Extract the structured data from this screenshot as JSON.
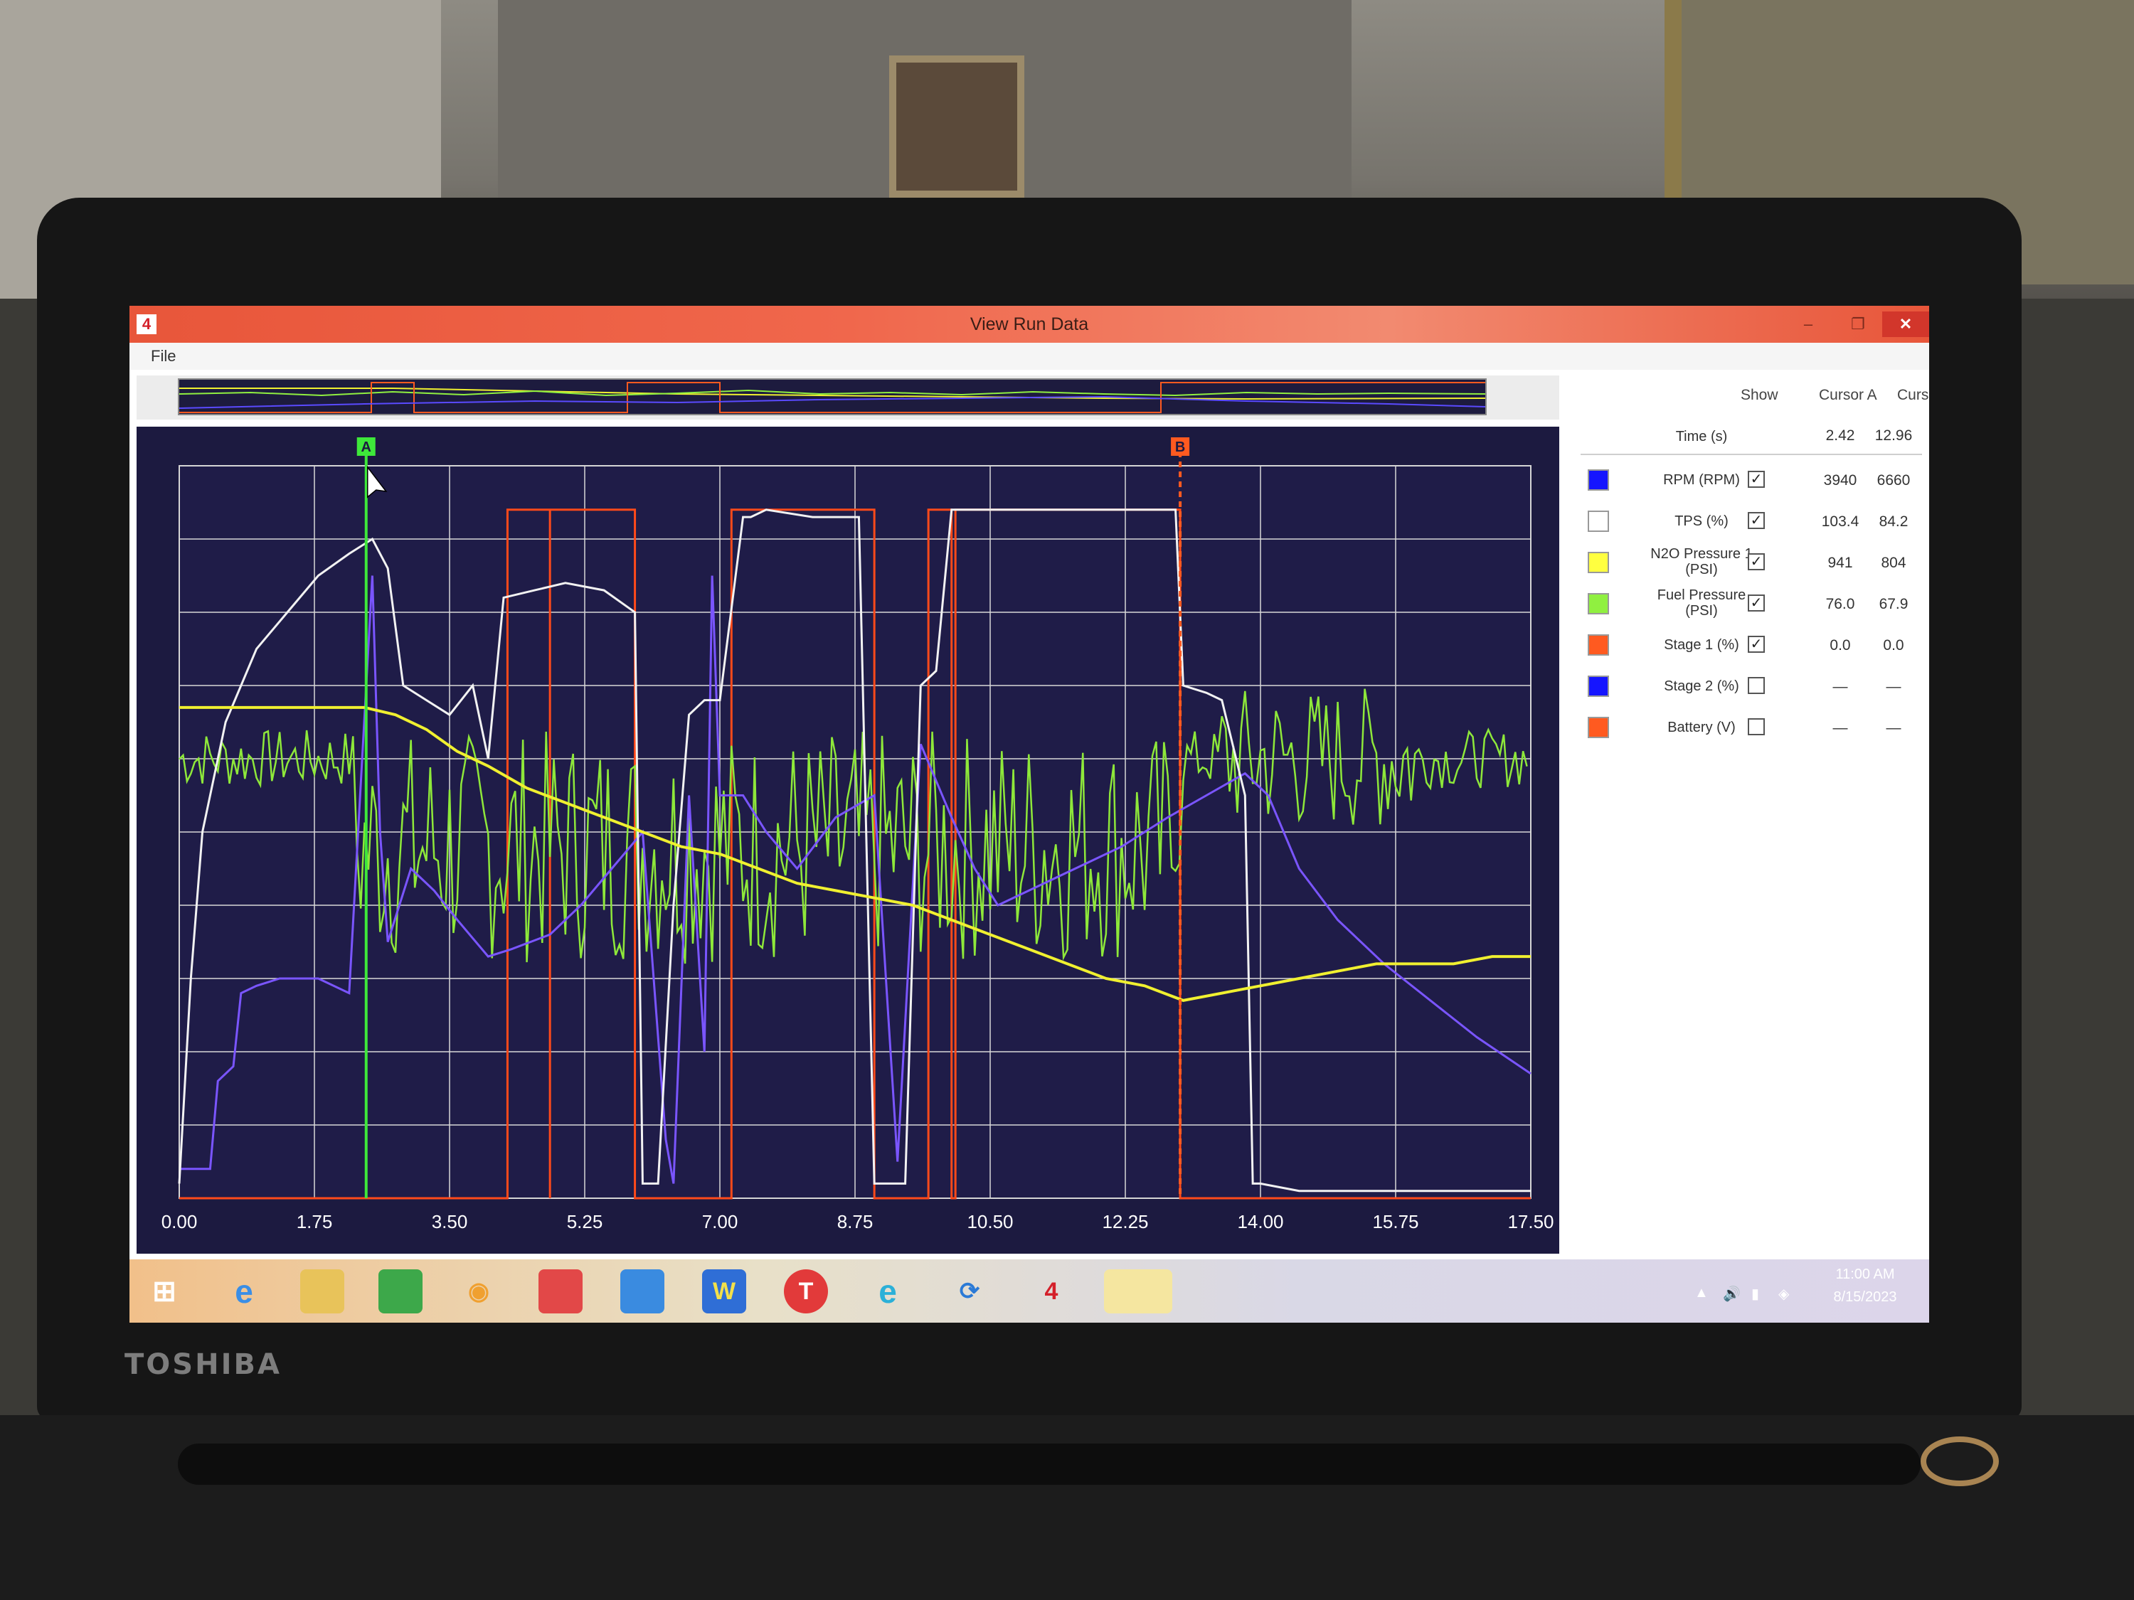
{
  "window": {
    "title": "View Run Data",
    "minimize": "–",
    "maximize": "❐",
    "close": "✕"
  },
  "menu": {
    "file": "File"
  },
  "device": {
    "brand": "TOSHIBA"
  },
  "legend": {
    "headers": {
      "show": "Show",
      "cursor_a": "Cursor A",
      "cursor_b": "Cursor B"
    },
    "time_label": "Time (s)",
    "time_a": "2.42",
    "time_b": "12.96",
    "rows": [
      {
        "label": "RPM (RPM)",
        "color": "#1515ff",
        "checked": true,
        "a": "3940",
        "b": "6660"
      },
      {
        "label": "TPS (%)",
        "color": "#ffffff",
        "checked": true,
        "a": "103.4",
        "b": "84.2"
      },
      {
        "label": "N2O Pressure 1 (PSI)",
        "color": "#ffff40",
        "checked": true,
        "a": "941",
        "b": "804"
      },
      {
        "label": "Fuel Pressure (PSI)",
        "color": "#90f040",
        "checked": true,
        "a": "76.0",
        "b": "67.9"
      },
      {
        "label": "Stage 1 (%)",
        "color": "#ff5a20",
        "checked": true,
        "a": "0.0",
        "b": "0.0"
      },
      {
        "label": "Stage 2 (%)",
        "color": "#1515ff",
        "checked": false,
        "a": "—",
        "b": "—"
      },
      {
        "label": "Battery (V)",
        "color": "#ff5a20",
        "checked": false,
        "a": "—",
        "b": "—"
      }
    ]
  },
  "cursors": {
    "a_label": "A",
    "b_label": "B",
    "a_time": 2.42,
    "b_time": 12.96
  },
  "chart_data": {
    "type": "line",
    "xlim": [
      0,
      17.5
    ],
    "ylim": [
      0,
      1
    ],
    "grid": true,
    "x_ticks": [
      "0.00",
      "1.75",
      "3.50",
      "5.25",
      "7.00",
      "8.75",
      "10.50",
      "12.25",
      "14.00",
      "15.75",
      "17.50"
    ],
    "series": [
      {
        "name": "RPM (RPM)",
        "color": "#7a55ff",
        "x": [
          0,
          0.4,
          0.5,
          0.7,
          0.8,
          1.0,
          1.3,
          1.8,
          2.2,
          2.5,
          2.6,
          2.7,
          3.0,
          3.3,
          3.6,
          4.0,
          4.3,
          4.8,
          5.2,
          5.6,
          6.0,
          6.3,
          6.4,
          6.6,
          6.8,
          6.9,
          7.0,
          7.3,
          7.6,
          8.0,
          8.5,
          9.0,
          9.3,
          9.6,
          10.0,
          10.3,
          10.6,
          11.0,
          11.6,
          12.2,
          12.8,
          13.3,
          13.8,
          14.1,
          14.5,
          15.0,
          15.6,
          16.2,
          16.8,
          17.5
        ],
        "y": [
          0.04,
          0.04,
          0.16,
          0.18,
          0.28,
          0.29,
          0.3,
          0.3,
          0.28,
          0.85,
          0.5,
          0.35,
          0.45,
          0.42,
          0.38,
          0.33,
          0.34,
          0.36,
          0.4,
          0.45,
          0.5,
          0.08,
          0.02,
          0.55,
          0.2,
          0.85,
          0.55,
          0.55,
          0.5,
          0.45,
          0.52,
          0.55,
          0.05,
          0.62,
          0.52,
          0.45,
          0.4,
          0.42,
          0.45,
          0.48,
          0.52,
          0.55,
          0.58,
          0.55,
          0.45,
          0.38,
          0.32,
          0.27,
          0.22,
          0.17
        ]
      },
      {
        "name": "TPS (%)",
        "color": "#f2f2f2",
        "x": [
          0,
          0.15,
          0.3,
          0.6,
          1.0,
          1.4,
          1.8,
          2.2,
          2.5,
          2.7,
          2.9,
          3.2,
          3.5,
          3.8,
          4.0,
          4.2,
          4.6,
          5.0,
          5.5,
          5.9,
          6.0,
          6.2,
          6.4,
          6.6,
          6.8,
          7.0,
          7.3,
          7.4,
          7.6,
          8.2,
          8.8,
          9.0,
          9.2,
          9.4,
          9.6,
          9.8,
          10.0,
          10.4,
          11.0,
          11.8,
          12.5,
          12.9,
          13.0,
          13.3,
          13.5,
          13.8,
          13.9,
          14.0,
          14.5,
          15.5,
          16.5,
          17.5
        ],
        "y": [
          0.02,
          0.3,
          0.5,
          0.65,
          0.75,
          0.8,
          0.85,
          0.88,
          0.9,
          0.86,
          0.7,
          0.68,
          0.66,
          0.7,
          0.6,
          0.82,
          0.83,
          0.84,
          0.83,
          0.8,
          0.02,
          0.02,
          0.4,
          0.66,
          0.68,
          0.68,
          0.93,
          0.93,
          0.94,
          0.93,
          0.93,
          0.02,
          0.02,
          0.02,
          0.7,
          0.72,
          0.94,
          0.94,
          0.94,
          0.94,
          0.94,
          0.94,
          0.7,
          0.69,
          0.68,
          0.55,
          0.02,
          0.02,
          0.01,
          0.01,
          0.01,
          0.01
        ]
      },
      {
        "name": "N2O Pressure 1 (PSI)",
        "color": "#f0f030",
        "x": [
          0,
          1.0,
          2.0,
          2.4,
          2.8,
          3.2,
          3.6,
          4.0,
          4.5,
          5.0,
          5.5,
          6.0,
          6.5,
          7.0,
          7.5,
          8.0,
          8.5,
          9.0,
          9.5,
          10.0,
          10.5,
          11.0,
          11.5,
          12.0,
          12.5,
          13.0,
          13.5,
          14.0,
          14.5,
          15.0,
          15.5,
          16.0,
          16.5,
          17.0,
          17.5
        ],
        "y": [
          0.67,
          0.67,
          0.67,
          0.67,
          0.66,
          0.64,
          0.61,
          0.59,
          0.56,
          0.54,
          0.52,
          0.5,
          0.48,
          0.47,
          0.45,
          0.43,
          0.42,
          0.41,
          0.4,
          0.38,
          0.36,
          0.34,
          0.32,
          0.3,
          0.29,
          0.27,
          0.28,
          0.29,
          0.3,
          0.31,
          0.32,
          0.32,
          0.32,
          0.33,
          0.33
        ]
      }
    ]
  }
}
